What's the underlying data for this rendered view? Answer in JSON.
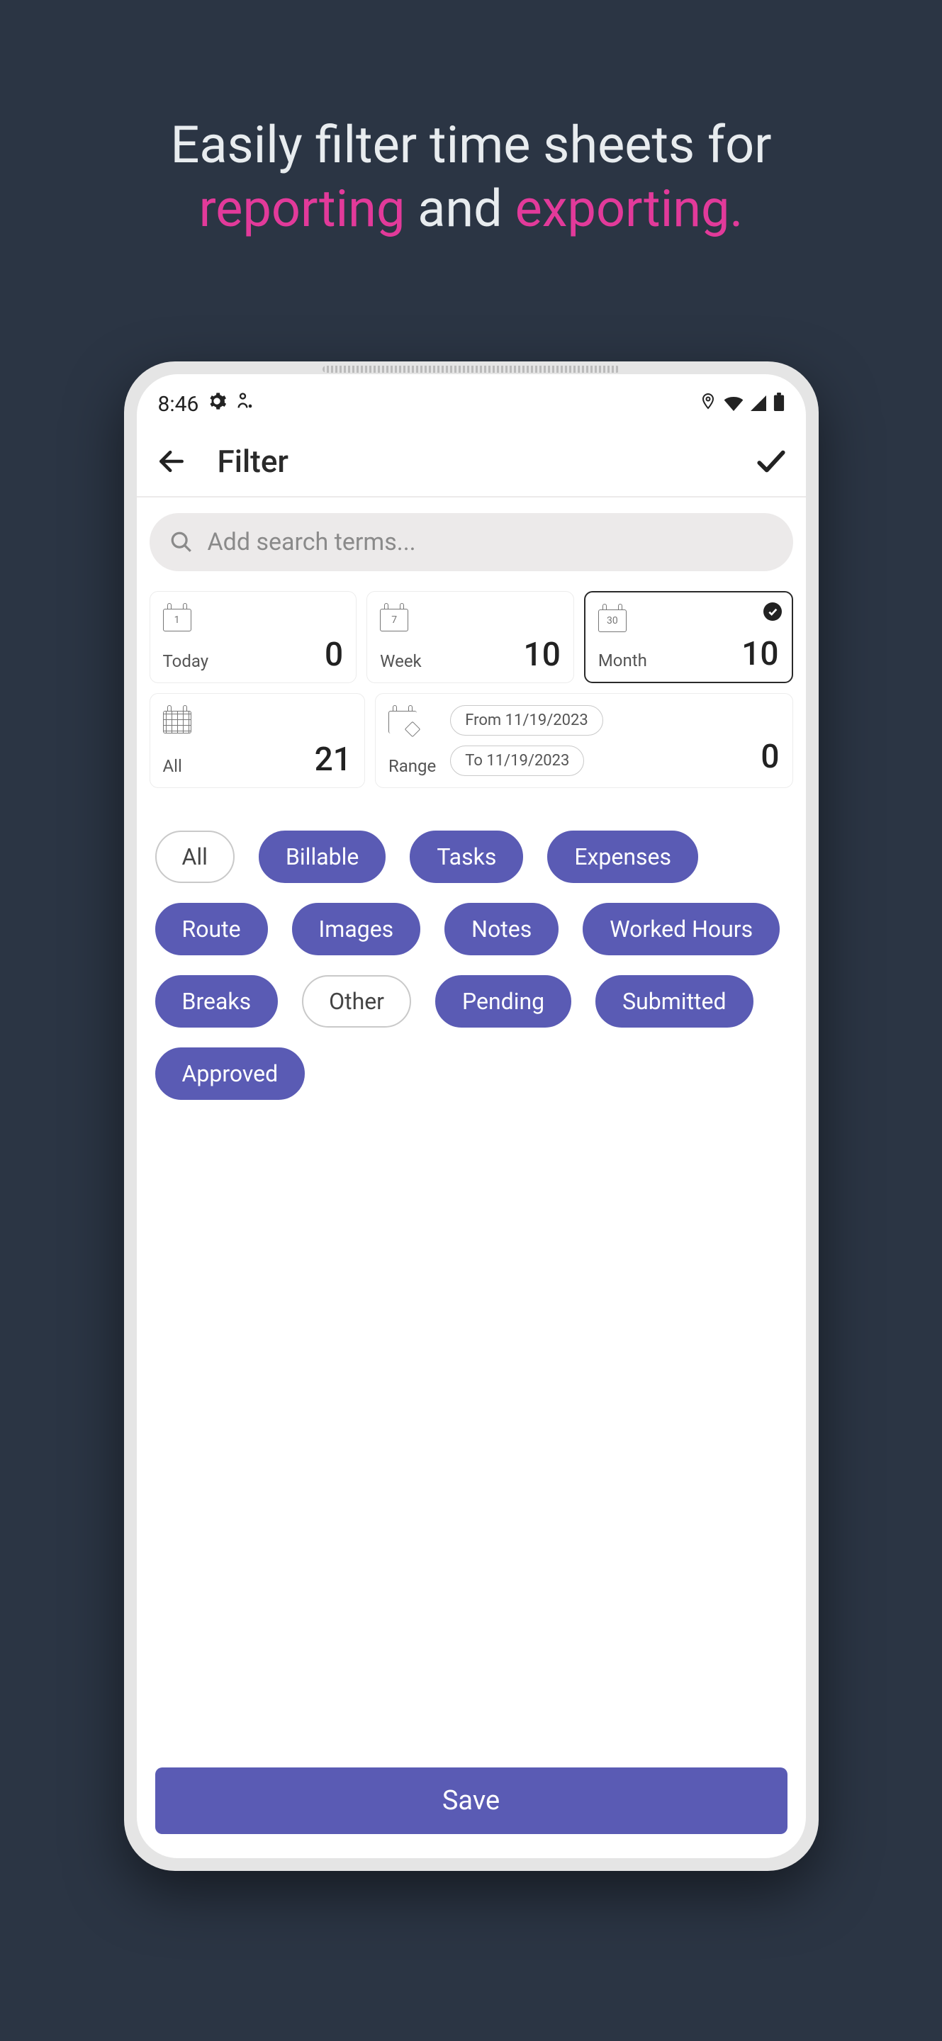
{
  "headline": {
    "part1": "Easily filter time sheets for",
    "part2": "reporting",
    "part3": " and ",
    "part4": "exporting."
  },
  "status_bar": {
    "time": "8:46"
  },
  "header": {
    "title": "Filter"
  },
  "search": {
    "placeholder": "Add search terms..."
  },
  "period_cards": {
    "today": {
      "label": "Today",
      "value": "0",
      "icon_num": "1",
      "selected": false
    },
    "week": {
      "label": "Week",
      "value": "10",
      "icon_num": "7",
      "selected": false
    },
    "month": {
      "label": "Month",
      "value": "10",
      "icon_num": "30",
      "selected": true
    },
    "all": {
      "label": "All",
      "value": "21",
      "selected": false
    },
    "range": {
      "label": "Range",
      "from": "From 11/19/2023",
      "to": "To 11/19/2023",
      "value": "0"
    }
  },
  "chips": [
    {
      "label": "All",
      "style": "outlined"
    },
    {
      "label": "Billable",
      "style": "filled"
    },
    {
      "label": "Tasks",
      "style": "filled"
    },
    {
      "label": "Expenses",
      "style": "filled"
    },
    {
      "label": "Route",
      "style": "filled"
    },
    {
      "label": "Images",
      "style": "filled"
    },
    {
      "label": "Notes",
      "style": "filled"
    },
    {
      "label": "Worked Hours",
      "style": "filled"
    },
    {
      "label": "Breaks",
      "style": "filled"
    },
    {
      "label": "Other",
      "style": "outlined"
    },
    {
      "label": "Pending",
      "style": "filled"
    },
    {
      "label": "Submitted",
      "style": "filled"
    },
    {
      "label": "Approved",
      "style": "filled"
    }
  ],
  "footer": {
    "save": "Save"
  }
}
